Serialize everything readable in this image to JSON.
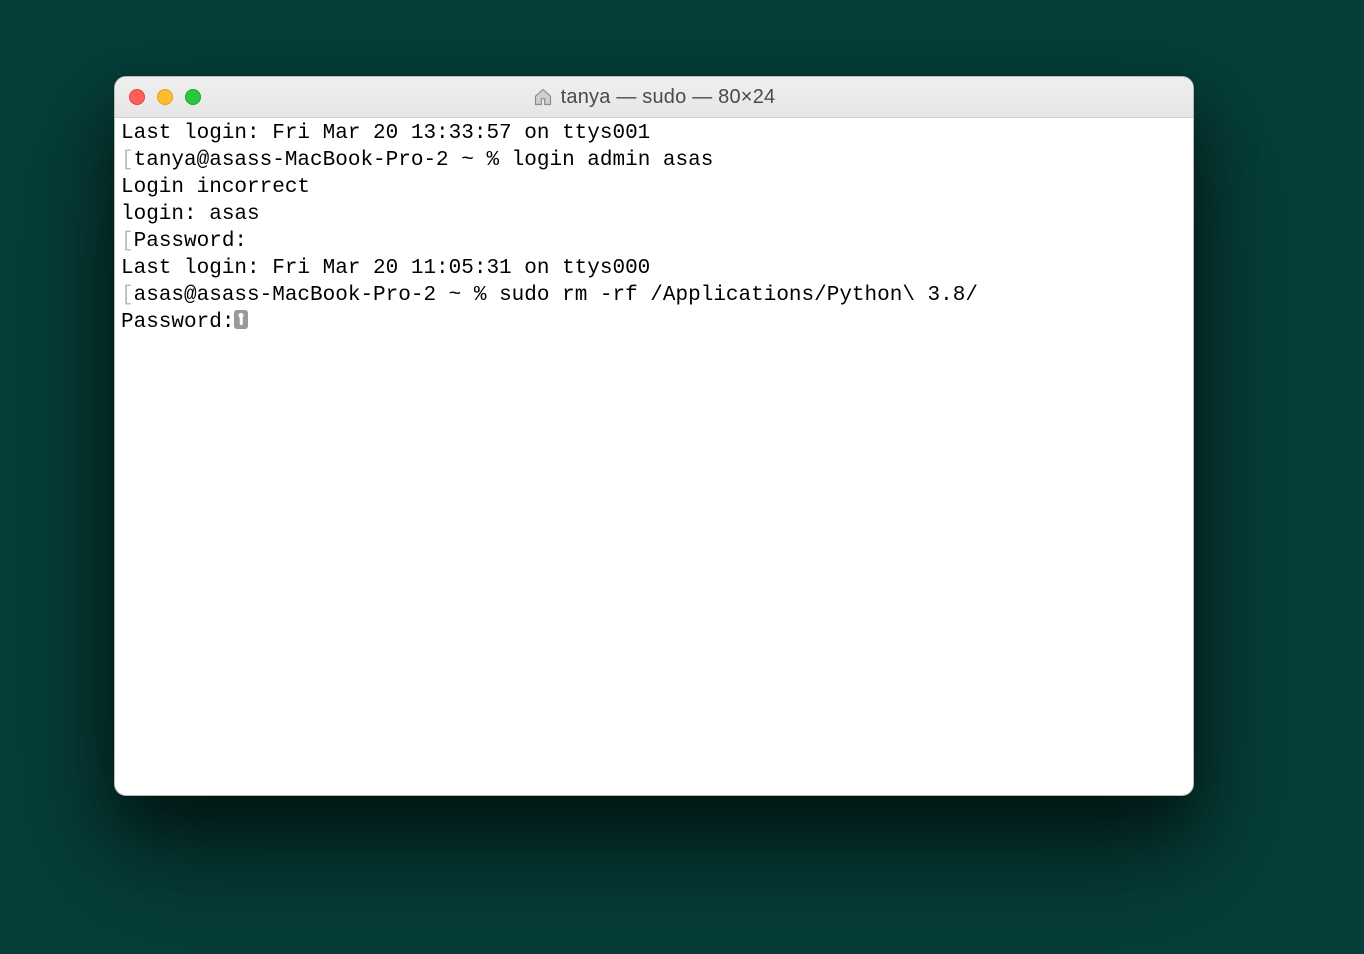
{
  "window": {
    "title": "tanya — sudo — 80×24"
  },
  "terminal": {
    "lines": {
      "l0": "Last login: Fri Mar 20 13:33:57 on ttys001",
      "l1_prompt": "tanya@asass-MacBook-Pro-2 ~ % ",
      "l1_cmd": "login admin asas",
      "l2": "Login incorrect",
      "l3": "login: asas",
      "l4": "Password:",
      "l5": "Last login: Fri Mar 20 11:05:31 on ttys000",
      "l6_prompt": "asas@asass-MacBook-Pro-2 ~ % ",
      "l6_cmd": "sudo rm -rf /Applications/Python\\ 3.8/",
      "l7": "Password:"
    }
  }
}
